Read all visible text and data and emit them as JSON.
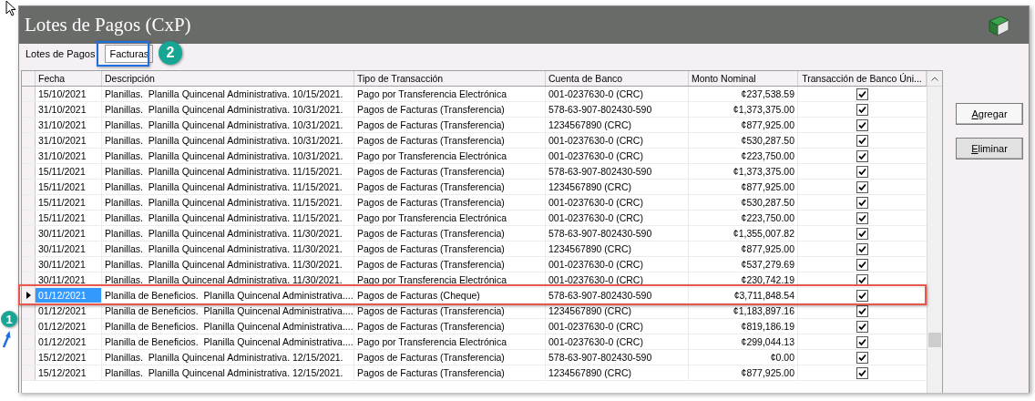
{
  "window": {
    "title": "Lotes de Pagos (CxP)"
  },
  "tabs": [
    {
      "label": "Lotes de Pagos",
      "selected": true
    },
    {
      "label": "Facturas",
      "selected": false
    }
  ],
  "table": {
    "columns": [
      "Fecha",
      "Descripción",
      "Tipo de Transacción",
      "Cuenta de Banco",
      "Monto Nominal",
      "Transacción de Banco Úni..."
    ],
    "rows": [
      {
        "selected": false,
        "checked": true,
        "cells": [
          "15/10/2021",
          "Planillas.  Planilla Quincenal Administrativa. 10/15/2021.",
          "Pago por Transferencia Electrónica",
          "001-0237630-0 (CRC)",
          "¢237,538.59"
        ]
      },
      {
        "selected": false,
        "checked": true,
        "cells": [
          "31/10/2021",
          "Planillas.  Planilla Quincenal Administrativa. 10/31/2021.",
          "Pagos de Facturas (Transferencia)",
          "578-63-907-802430-590",
          "¢1,373,375.00"
        ]
      },
      {
        "selected": false,
        "checked": true,
        "cells": [
          "31/10/2021",
          "Planillas.  Planilla Quincenal Administrativa. 10/31/2021.",
          "Pagos de Facturas (Transferencia)",
          "1234567890 (CRC)",
          "¢877,925.00"
        ]
      },
      {
        "selected": false,
        "checked": true,
        "cells": [
          "31/10/2021",
          "Planillas.  Planilla Quincenal Administrativa. 10/31/2021.",
          "Pagos de Facturas (Transferencia)",
          "001-0237630-0 (CRC)",
          "¢530,287.50"
        ]
      },
      {
        "selected": false,
        "checked": true,
        "cells": [
          "31/10/2021",
          "Planillas.  Planilla Quincenal Administrativa. 10/31/2021.",
          "Pago por Transferencia Electrónica",
          "001-0237630-0 (CRC)",
          "¢223,750.00"
        ]
      },
      {
        "selected": false,
        "checked": true,
        "cells": [
          "15/11/2021",
          "Planillas.  Planilla Quincenal Administrativa. 11/15/2021.",
          "Pagos de Facturas (Transferencia)",
          "578-63-907-802430-590",
          "¢1,373,375.00"
        ]
      },
      {
        "selected": false,
        "checked": true,
        "cells": [
          "15/11/2021",
          "Planillas.  Planilla Quincenal Administrativa. 11/15/2021.",
          "Pagos de Facturas (Transferencia)",
          "1234567890 (CRC)",
          "¢877,925.00"
        ]
      },
      {
        "selected": false,
        "checked": true,
        "cells": [
          "15/11/2021",
          "Planillas.  Planilla Quincenal Administrativa. 11/15/2021.",
          "Pagos de Facturas (Transferencia)",
          "001-0237630-0 (CRC)",
          "¢530,287.50"
        ]
      },
      {
        "selected": false,
        "checked": true,
        "cells": [
          "15/11/2021",
          "Planillas.  Planilla Quincenal Administrativa. 11/15/2021.",
          "Pago por Transferencia Electrónica",
          "001-0237630-0 (CRC)",
          "¢223,750.00"
        ]
      },
      {
        "selected": false,
        "checked": true,
        "cells": [
          "30/11/2021",
          "Planillas.  Planilla Quincenal Administrativa. 11/30/2021.",
          "Pagos de Facturas (Transferencia)",
          "578-63-907-802430-590",
          "¢1,355,007.82"
        ]
      },
      {
        "selected": false,
        "checked": true,
        "cells": [
          "30/11/2021",
          "Planillas.  Planilla Quincenal Administrativa. 11/30/2021.",
          "Pagos de Facturas (Transferencia)",
          "1234567890 (CRC)",
          "¢877,925.00"
        ]
      },
      {
        "selected": false,
        "checked": true,
        "cells": [
          "30/11/2021",
          "Planillas.  Planilla Quincenal Administrativa. 11/30/2021.",
          "Pagos de Facturas (Transferencia)",
          "001-0237630-0 (CRC)",
          "¢537,279.69"
        ]
      },
      {
        "selected": false,
        "checked": true,
        "cells": [
          "30/11/2021",
          "Planillas.  Planilla Quincenal Administrativa. 11/30/2021.",
          "Pago por Transferencia Electrónica",
          "001-0237630-0 (CRC)",
          "¢230,742.19"
        ]
      },
      {
        "selected": true,
        "checked": true,
        "cells": [
          "01/12/2021",
          "Planilla de Beneficios.  Planilla Quincenal Administrativa....",
          "Pagos de Facturas (Cheque)",
          "578-63-907-802430-590",
          "¢3,711,848.54"
        ]
      },
      {
        "selected": false,
        "checked": true,
        "cells": [
          "01/12/2021",
          "Planilla de Beneficios.  Planilla Quincenal Administrativa....",
          "Pagos de Facturas (Transferencia)",
          "1234567890 (CRC)",
          "¢1,183,897.16"
        ]
      },
      {
        "selected": false,
        "checked": true,
        "cells": [
          "01/12/2021",
          "Planilla de Beneficios.  Planilla Quincenal Administrativa....",
          "Pagos de Facturas (Transferencia)",
          "001-0237630-0 (CRC)",
          "¢819,186.19"
        ]
      },
      {
        "selected": false,
        "checked": true,
        "cells": [
          "01/12/2021",
          "Planilla de Beneficios.  Planilla Quincenal Administrativa....",
          "Pago por Transferencia Electrónica",
          "001-0237630-0 (CRC)",
          "¢299,044.13"
        ]
      },
      {
        "selected": false,
        "checked": true,
        "cells": [
          "15/12/2021",
          "Planillas.  Planilla Quincenal Administrativa. 12/15/2021.",
          "Pagos de Facturas (Transferencia)",
          "578-63-907-802430-590",
          "¢0.00"
        ]
      },
      {
        "selected": false,
        "checked": true,
        "cells": [
          "15/12/2021",
          "Planillas.  Planilla Quincenal Administrativa. 12/15/2021.",
          "Pagos de Facturas (Transferencia)",
          "1234567890 (CRC)",
          "¢877,925.00"
        ]
      }
    ]
  },
  "buttons": [
    "Agregar",
    "Eliminar"
  ],
  "annotations": [
    {
      "label": "2"
    },
    {
      "label": "1"
    }
  ]
}
